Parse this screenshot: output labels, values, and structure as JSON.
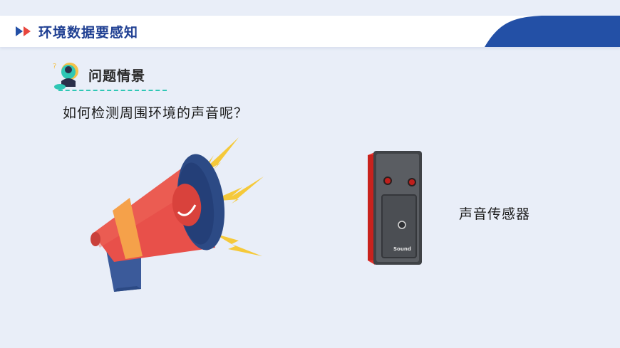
{
  "header": {
    "title": "环境数据要感知",
    "icon": "double-arrow-icon",
    "accent_color": "#2350a6"
  },
  "section": {
    "title": "问题情景",
    "icon": "thinking-person-icon",
    "underline_color": "#2fc7b5"
  },
  "question": "如何检测周围环境的声音呢？",
  "megaphone": {
    "icon": "megaphone-illustration"
  },
  "sensor": {
    "device_text": "Sound",
    "label": "声音传感器"
  }
}
